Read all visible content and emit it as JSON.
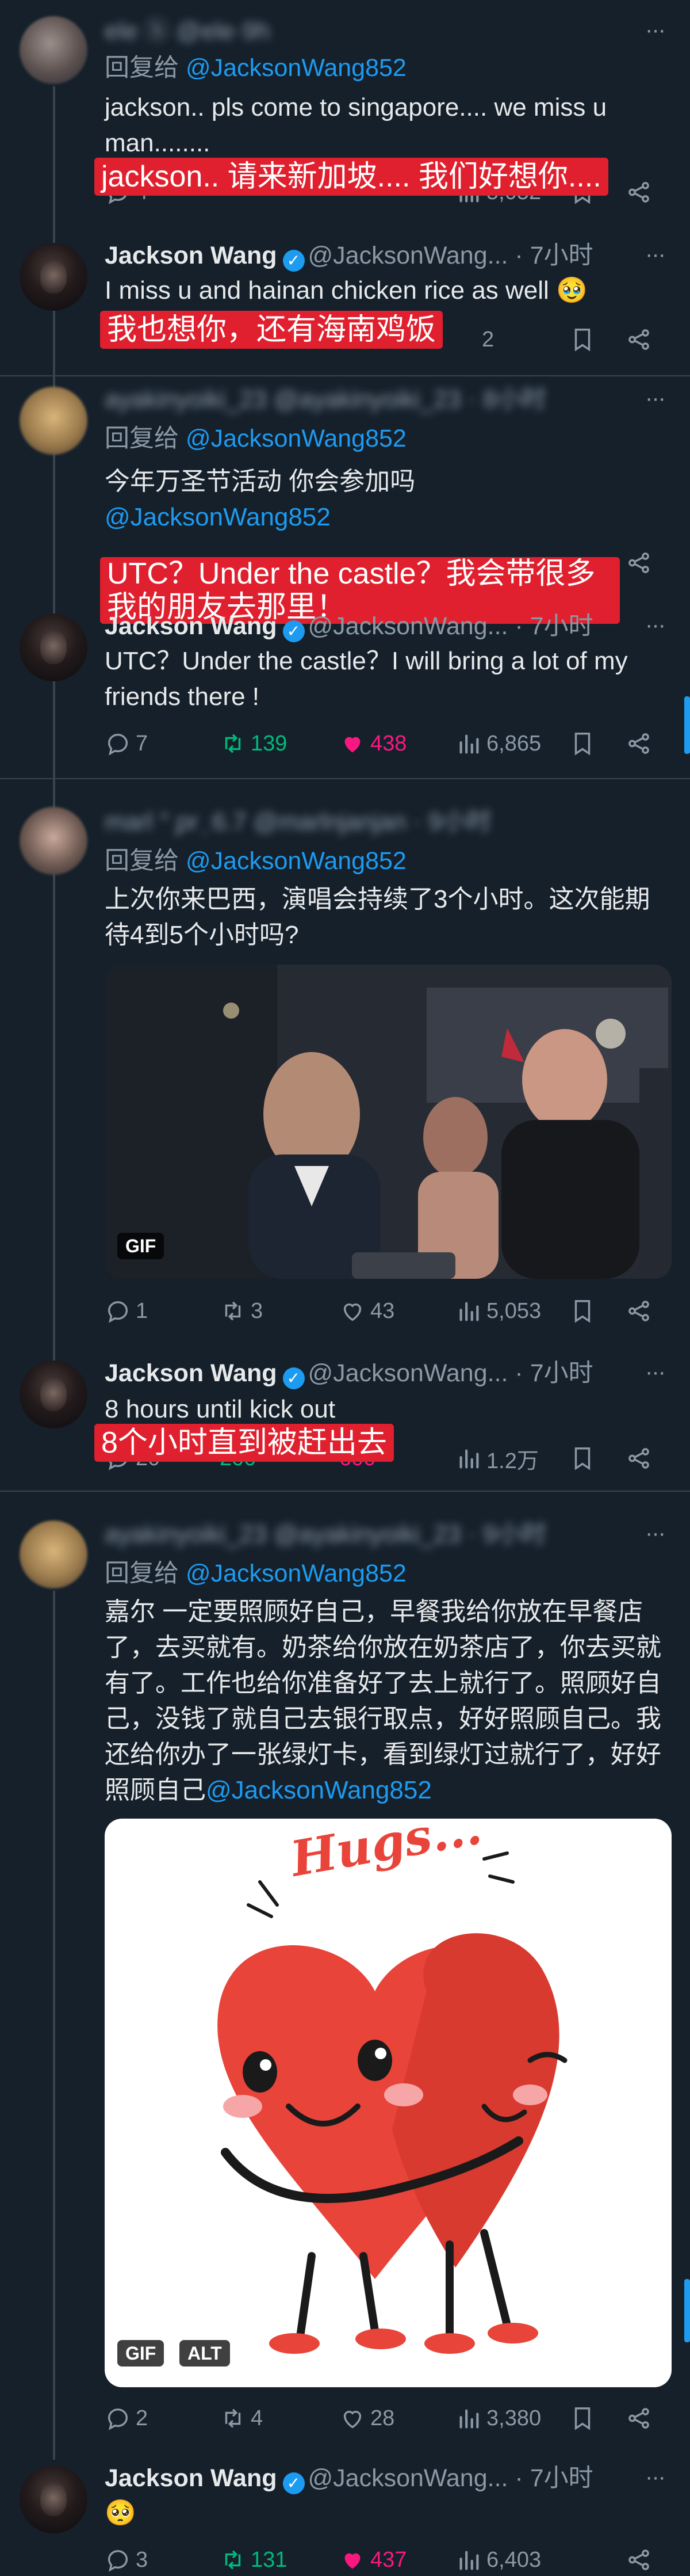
{
  "common": {
    "replying_to_prefix": "回复给 ",
    "mention": "@JacksonWang852",
    "jw_name": "Jackson Wang",
    "jw_handle": "@JacksonWang...",
    "time_7h": "· 7小时",
    "more_dots": "···"
  },
  "tweets": [
    {
      "blur_name": "ele ⓑ",
      "blur_handle": "@ele·9h",
      "text": "jackson.. pls come to singapore.... we miss u man........",
      "subtitle": "jackson.. 请来新加坡.... 我们好想你....",
      "stats": {
        "reply": "4",
        "retweet": "",
        "like": "",
        "views": "5,052"
      }
    },
    {
      "text": "I miss u and hainan chicken rice as well 🥹",
      "subtitle": "我也想你，还有海南鸡饭",
      "stats": {
        "views": "2"
      }
    },
    {
      "blur_name": "ayakinyoiki_23",
      "blur_handle": "@ayakinyoiki_23 · 8小时",
      "text_line1": "今年万圣节活动 你会参加吗",
      "mention_line": "@JacksonWang852",
      "subtitle": "UTC？Under the castle？我会带很多我的朋友去那里！"
    },
    {
      "text": "UTC？Under the castle？I will bring a lot of my friends there !",
      "stats": {
        "reply": "7",
        "retweet": "139",
        "like": "438",
        "views": "6,865"
      }
    },
    {
      "blur_name": "marl ° ̗pr ̗ 6.7",
      "blur_handle": "@marlnjanjan · 9小时",
      "text": "上次你来巴西，演唱会持续了3个小时。这次能期待4到5个小时吗?",
      "media_badge": "GIF",
      "stats": {
        "reply": "1",
        "retweet": "3",
        "like": "43",
        "views": "5,053"
      }
    },
    {
      "text": "8 hours until kick out",
      "subtitle": "8个小时直到被赶出去",
      "stats": {
        "reply": "20",
        "retweet": "200",
        "like": "600",
        "views": "1.2万"
      }
    },
    {
      "blur_name": "ayakinyoiki_23",
      "blur_handle": "@ayakinyoiki_23 · 9小时",
      "text": "嘉尔 一定要照顾好自己，早餐我给你放在早餐店了，去买就有。奶茶给你放在奶茶店了，你去买就有了。工作也给你准备好了去上就行了。照顾好自己，没钱了就自己去银行取点，好好照顾自己。我还给你办了一张绿灯卡，看到绿灯过就行了，好好照顾自己",
      "media_text": "Hugs...",
      "badge_gif": "GIF",
      "badge_alt": "ALT",
      "stats": {
        "reply": "2",
        "retweet": "4",
        "like": "28",
        "views": "3,380"
      }
    },
    {
      "text": "🥺",
      "stats": {
        "reply": "3",
        "retweet": "131",
        "like": "437",
        "views": "6,403"
      }
    }
  ],
  "colors": {
    "bg": "#15202b",
    "accent": "#1d9bf0",
    "retweet": "#00ba7c",
    "like": "#f91880",
    "subtitle_bg": "#e0202e"
  }
}
